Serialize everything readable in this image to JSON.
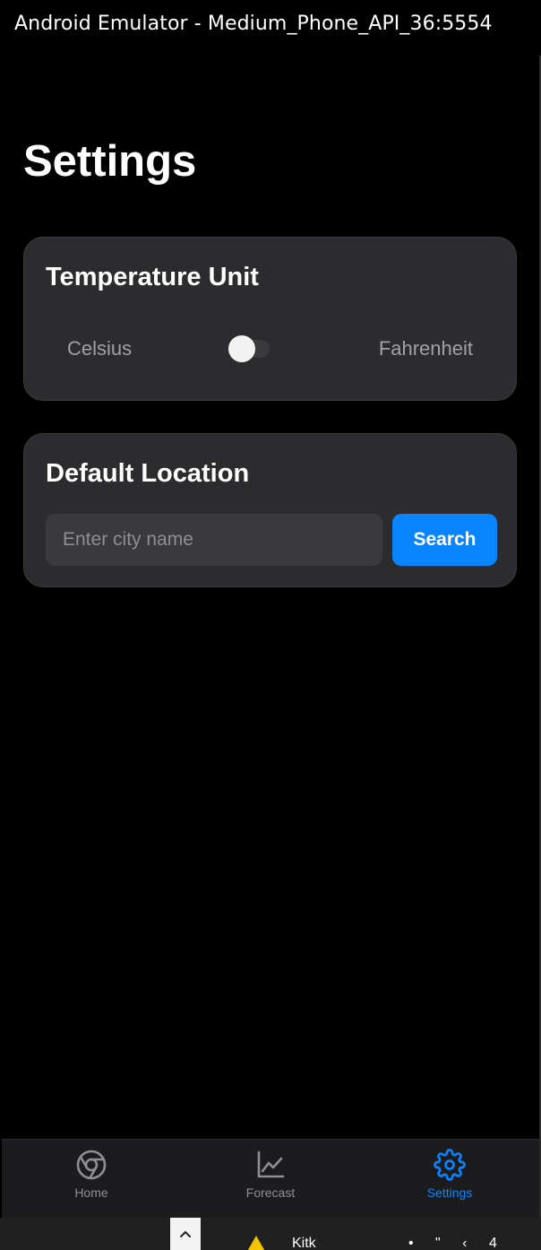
{
  "window": {
    "title": "Android Emulator - Medium_Phone_API_36:5554"
  },
  "page": {
    "title": "Settings"
  },
  "temperature_unit": {
    "title": "Temperature Unit",
    "left_label": "Celsius",
    "right_label": "Fahrenheit",
    "fahrenheit_enabled": false
  },
  "default_location": {
    "title": "Default Location",
    "input_value": "",
    "input_placeholder": "Enter city name",
    "button_label": "Search"
  },
  "tab_bar": {
    "active_tab": "Settings",
    "tabs": [
      {
        "label": "Home",
        "icon": "chrome-circle-icon"
      },
      {
        "label": "Forecast",
        "icon": "line-chart-icon"
      },
      {
        "label": "Settings",
        "icon": "gear-icon"
      }
    ]
  },
  "taskbar": {
    "partial_text": "Kitk",
    "partial_glyphs": "• \" ‹ 4"
  },
  "colors": {
    "background": "#000000",
    "card": "#2c2c2e",
    "input": "#3a3a3c",
    "accent": "#0a84ff",
    "muted_text": "#a1a1a6",
    "inactive_tab": "#8e8e93"
  }
}
